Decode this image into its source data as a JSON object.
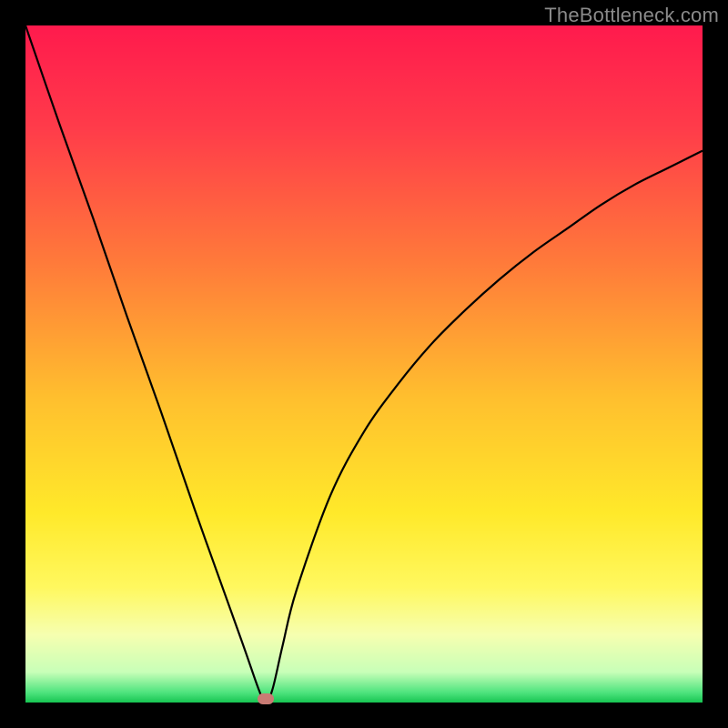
{
  "watermark": "TheBottleneck.com",
  "chart_data": {
    "type": "line",
    "title": "",
    "xlabel": "",
    "ylabel": "",
    "xlim": [
      0,
      1
    ],
    "ylim": [
      0,
      1
    ],
    "min_point": {
      "x": 0.355,
      "y": 0.0
    },
    "series": [
      {
        "name": "curve",
        "x": [
          0.0,
          0.05,
          0.1,
          0.15,
          0.2,
          0.25,
          0.3,
          0.325,
          0.345,
          0.355,
          0.365,
          0.38,
          0.4,
          0.45,
          0.5,
          0.55,
          0.6,
          0.65,
          0.7,
          0.75,
          0.8,
          0.85,
          0.9,
          0.95,
          1.0
        ],
        "y": [
          1.0,
          0.855,
          0.715,
          0.57,
          0.43,
          0.285,
          0.145,
          0.075,
          0.018,
          0.0,
          0.02,
          0.085,
          0.165,
          0.305,
          0.4,
          0.47,
          0.53,
          0.58,
          0.625,
          0.665,
          0.7,
          0.735,
          0.765,
          0.79,
          0.815
        ]
      }
    ],
    "gradient_stops": [
      {
        "offset": 0.0,
        "color": "#ff1a4d"
      },
      {
        "offset": 0.15,
        "color": "#ff3b4a"
      },
      {
        "offset": 0.35,
        "color": "#ff7a3a"
      },
      {
        "offset": 0.55,
        "color": "#ffbf2e"
      },
      {
        "offset": 0.72,
        "color": "#ffe92a"
      },
      {
        "offset": 0.83,
        "color": "#fff85f"
      },
      {
        "offset": 0.9,
        "color": "#f6ffb0"
      },
      {
        "offset": 0.955,
        "color": "#c8ffb8"
      },
      {
        "offset": 0.985,
        "color": "#4fe47e"
      },
      {
        "offset": 1.0,
        "color": "#17c552"
      }
    ]
  }
}
